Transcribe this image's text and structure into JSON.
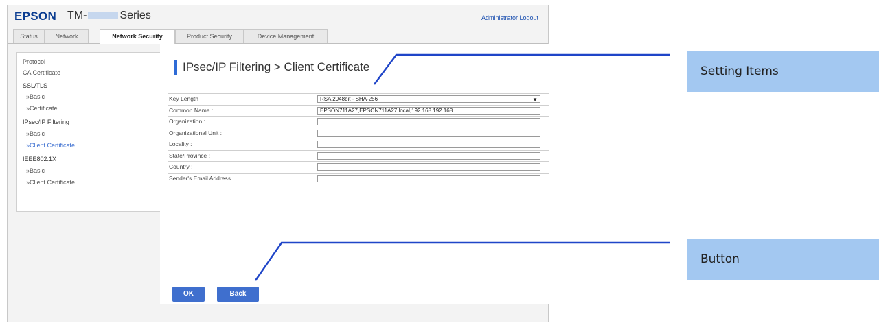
{
  "header": {
    "logo": "EPSON",
    "model_prefix": "TM-",
    "model_suffix": "Series",
    "logout_label": "Administrator Logout"
  },
  "tabs": [
    {
      "label": "Status"
    },
    {
      "label": "Network"
    },
    {
      "label": "Network Security",
      "active": true
    },
    {
      "label": "Product Security"
    },
    {
      "label": "Device Management"
    }
  ],
  "sidebar": {
    "items": [
      {
        "label": "Protocol"
      },
      {
        "label": "CA Certificate"
      },
      {
        "label": "SSL/TLS"
      },
      {
        "label": "»Basic"
      },
      {
        "label": "»Certificate"
      },
      {
        "label": "IPsec/IP Filtering"
      },
      {
        "label": "»Basic"
      },
      {
        "label": "»Client Certificate",
        "active": true
      },
      {
        "label": "IEEE802.1X"
      },
      {
        "label": "»Basic"
      },
      {
        "label": "»Client Certificate"
      }
    ]
  },
  "main": {
    "title": "IPsec/IP Filtering > Client Certificate",
    "fields": [
      {
        "label": "Key Length :",
        "value": "RSA 2048bit - SHA-256"
      },
      {
        "label": "Common Name :",
        "value": "EPSON711A27,EPSON711A27.local,192.168.192.168"
      },
      {
        "label": "Organization :",
        "value": ""
      },
      {
        "label": "Organizational Unit :",
        "value": ""
      },
      {
        "label": "Locality :",
        "value": ""
      },
      {
        "label": "State/Province :",
        "value": ""
      },
      {
        "label": "Country :",
        "value": ""
      },
      {
        "label": "Sender's Email Address :",
        "value": ""
      }
    ],
    "ok_label": "OK",
    "back_label": "Back"
  },
  "callouts": {
    "setting_items": "Setting Items",
    "button": "Button"
  },
  "colors": {
    "brand": "#0b3d91",
    "accent": "#2e6bd6",
    "button": "#3f6fce",
    "callout_bg": "#a3c8f1",
    "leader_line": "#1f45c8"
  },
  "icons": {
    "select_arrow": "chevron-down-icon"
  }
}
